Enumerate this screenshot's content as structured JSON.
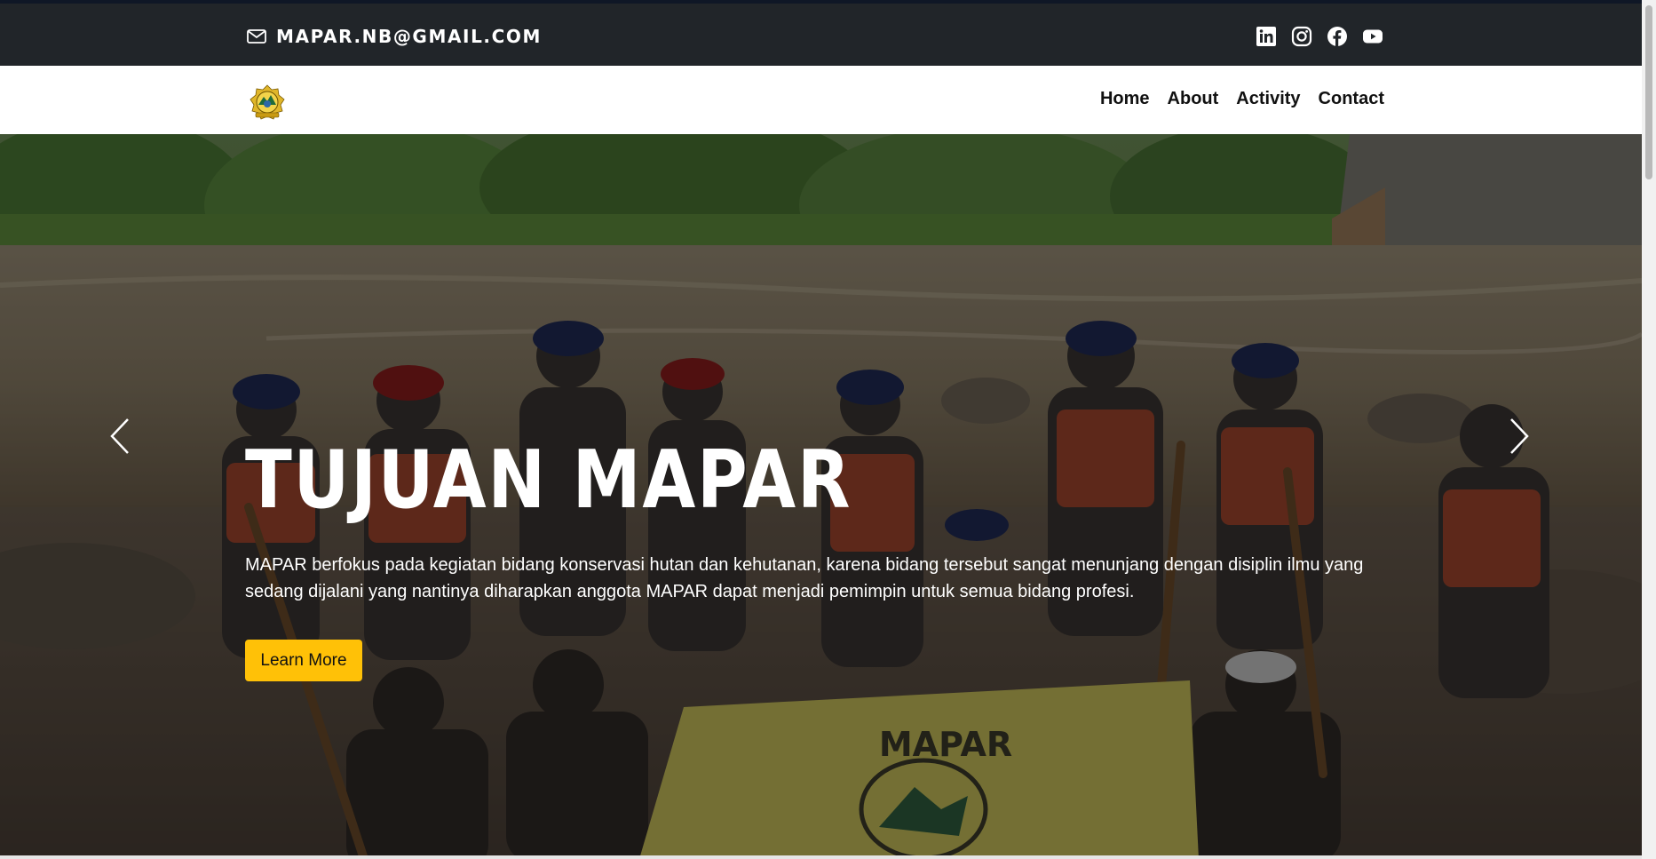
{
  "topbar": {
    "email": "MAPAR.NB@GMAIL.COM",
    "social": [
      "linkedin-icon",
      "instagram-icon",
      "facebook-icon",
      "youtube-icon"
    ]
  },
  "navbar": {
    "logo": "mapar-logo",
    "links": [
      "Home",
      "About",
      "Activity",
      "Contact"
    ]
  },
  "hero": {
    "title": "TUJUAN MAPAR",
    "description": "MAPAR berfokus pada kegiatan bidang konservasi hutan dan kehutanan, karena bidang tersebut sangat menunjang dengan disiplin ilmu yang sedang dijalani yang nantinya diharapkan anggota MAPAR dapat menjadi pemimpin untuk semua bidang profesi.",
    "button": "Learn More",
    "banner_text": "MAPAR",
    "prev_icon": "chevron-left-icon",
    "next_icon": "chevron-right-icon"
  },
  "colors": {
    "topbar_bg": "#212529",
    "accent": "#ffc107",
    "navbar_bg": "#ffffff"
  }
}
